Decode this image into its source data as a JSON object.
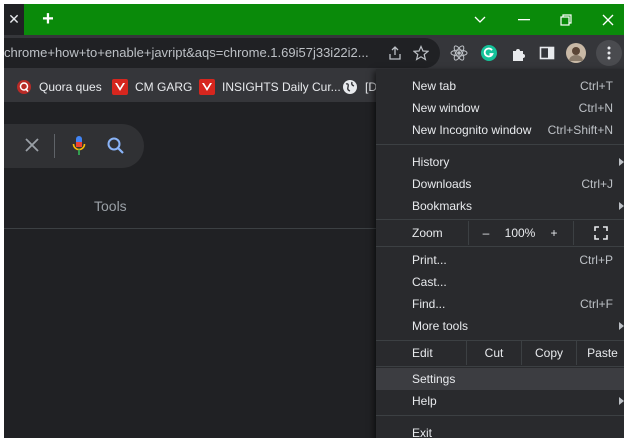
{
  "window": {
    "tab_close": "✕",
    "new_tab": "+",
    "controls": {
      "dropdown": "﹀",
      "minimize": "—",
      "restore": "❐",
      "close": "✕"
    }
  },
  "toolbar": {
    "url": "chrome+how+to+enable+javript&aqs=chrome.1.69i57j33i22i2..."
  },
  "bookmarks": [
    {
      "label": "Quora ques",
      "icon": "quora-icon"
    },
    {
      "label": "CM GARG",
      "icon": "insights-icon"
    },
    {
      "label": "INSIGHTS Daily Cur...",
      "icon": "insights-icon"
    },
    {
      "label": "[D",
      "icon": "globe-icon"
    }
  ],
  "page": {
    "tools_label": "Tools"
  },
  "menu": {
    "new_tab": {
      "label": "New tab",
      "shortcut": "Ctrl+T"
    },
    "new_window": {
      "label": "New window",
      "shortcut": "Ctrl+N"
    },
    "new_incognito": {
      "label": "New Incognito window",
      "shortcut": "Ctrl+Shift+N"
    },
    "history": {
      "label": "History"
    },
    "downloads": {
      "label": "Downloads",
      "shortcut": "Ctrl+J"
    },
    "bookmarks": {
      "label": "Bookmarks"
    },
    "zoom": {
      "label": "Zoom",
      "minus": "–",
      "value": "100%",
      "plus": "+"
    },
    "print": {
      "label": "Print...",
      "shortcut": "Ctrl+P"
    },
    "cast": {
      "label": "Cast..."
    },
    "find": {
      "label": "Find...",
      "shortcut": "Ctrl+F"
    },
    "more_tools": {
      "label": "More tools"
    },
    "edit": {
      "label": "Edit",
      "cut": "Cut",
      "copy": "Copy",
      "paste": "Paste"
    },
    "settings": {
      "label": "Settings"
    },
    "help": {
      "label": "Help"
    },
    "exit": {
      "label": "Exit"
    }
  },
  "colors": {
    "titlebar": "#0a8a0a",
    "menu_bg": "#292a2d",
    "highlight": "#3c3d41"
  }
}
